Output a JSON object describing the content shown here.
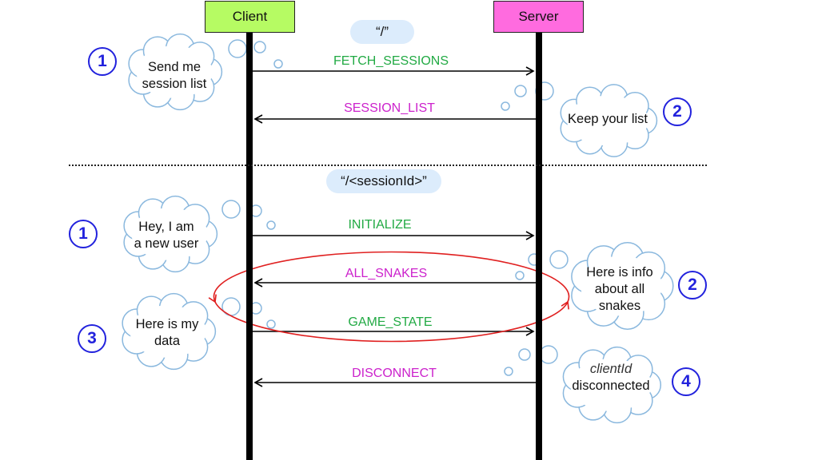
{
  "actors": {
    "client": "Client",
    "server": "Server"
  },
  "colors": {
    "client_box": "#b6fb63",
    "server_box": "#ff6bdf",
    "request": "#22aa44",
    "response": "#cc22cc",
    "step_number": "#2222dd",
    "loop": "#e02020",
    "route_pill": "#dcecfc"
  },
  "routes": {
    "root": "“/”",
    "session": "“/<sessionId>”"
  },
  "messages": [
    {
      "label": "FETCH_SESSIONS",
      "direction": "client-to-server",
      "color": "#22aa44"
    },
    {
      "label": "SESSION_LIST",
      "direction": "server-to-client",
      "color": "#cc22cc"
    },
    {
      "label": "INITIALIZE",
      "direction": "client-to-server",
      "color": "#22aa44"
    },
    {
      "label": "ALL_SNAKES",
      "direction": "server-to-client",
      "color": "#cc22cc"
    },
    {
      "label": "GAME_STATE",
      "direction": "client-to-server",
      "color": "#22aa44"
    },
    {
      "label": "DISCONNECT",
      "direction": "server-to-client",
      "color": "#cc22cc"
    }
  ],
  "thoughts": [
    {
      "step": "1",
      "lines": [
        "Send me",
        "session list"
      ]
    },
    {
      "step": "2",
      "lines": [
        "Keep your list"
      ]
    },
    {
      "step": "1",
      "lines": [
        "Hey, I am",
        "a new user"
      ]
    },
    {
      "step": "2",
      "lines": [
        "Here is info",
        "about all",
        "snakes"
      ]
    },
    {
      "step": "3",
      "lines": [
        "Here is my",
        "data"
      ]
    },
    {
      "step": "4",
      "lines": [
        "clientId",
        "disconnected"
      ]
    }
  ]
}
